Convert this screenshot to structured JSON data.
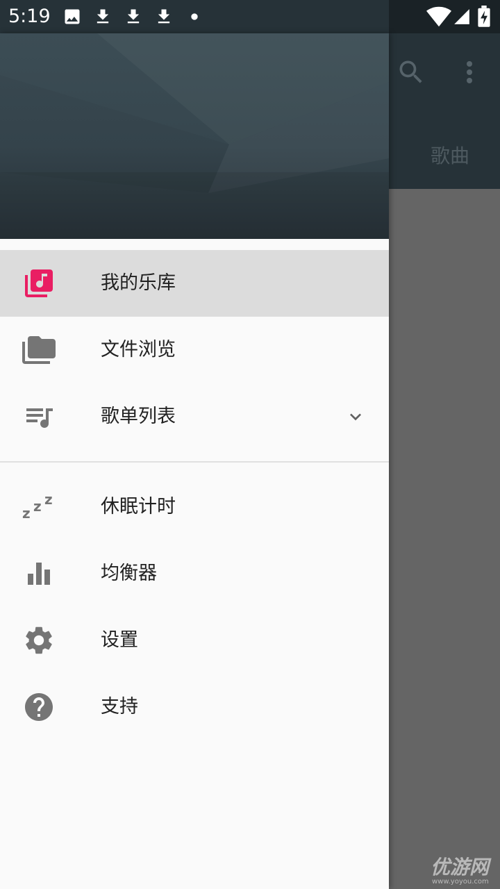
{
  "status_bar": {
    "time": "5:19",
    "left_icons": [
      "image-icon",
      "download-icon",
      "download-icon",
      "download-icon",
      "dot-icon"
    ],
    "right_icons": [
      "wifi-icon",
      "signal-icon",
      "battery-charging-icon"
    ]
  },
  "background_app": {
    "tab_label": "歌曲",
    "toolbar_color": "#263238",
    "actions": [
      "search-icon",
      "more-vert-icon"
    ]
  },
  "drawer": {
    "header_color": "#37474f",
    "items": [
      {
        "label": "我的乐库",
        "icon": "library-music-icon",
        "active": true,
        "icon_color": "#e91e63"
      },
      {
        "label": "文件浏览",
        "icon": "folder-copy-icon",
        "active": false
      },
      {
        "label": "歌单列表",
        "icon": "queue-music-icon",
        "active": false,
        "expandable": true
      }
    ],
    "items2": [
      {
        "label": "休眠计时",
        "icon": "sleep-zzz-icon"
      },
      {
        "label": "均衡器",
        "icon": "equalizer-icon"
      },
      {
        "label": "设置",
        "icon": "settings-gear-icon"
      },
      {
        "label": "支持",
        "icon": "help-icon"
      }
    ]
  },
  "watermark": {
    "text": "优游网",
    "sub": "www.yoyou.com"
  }
}
